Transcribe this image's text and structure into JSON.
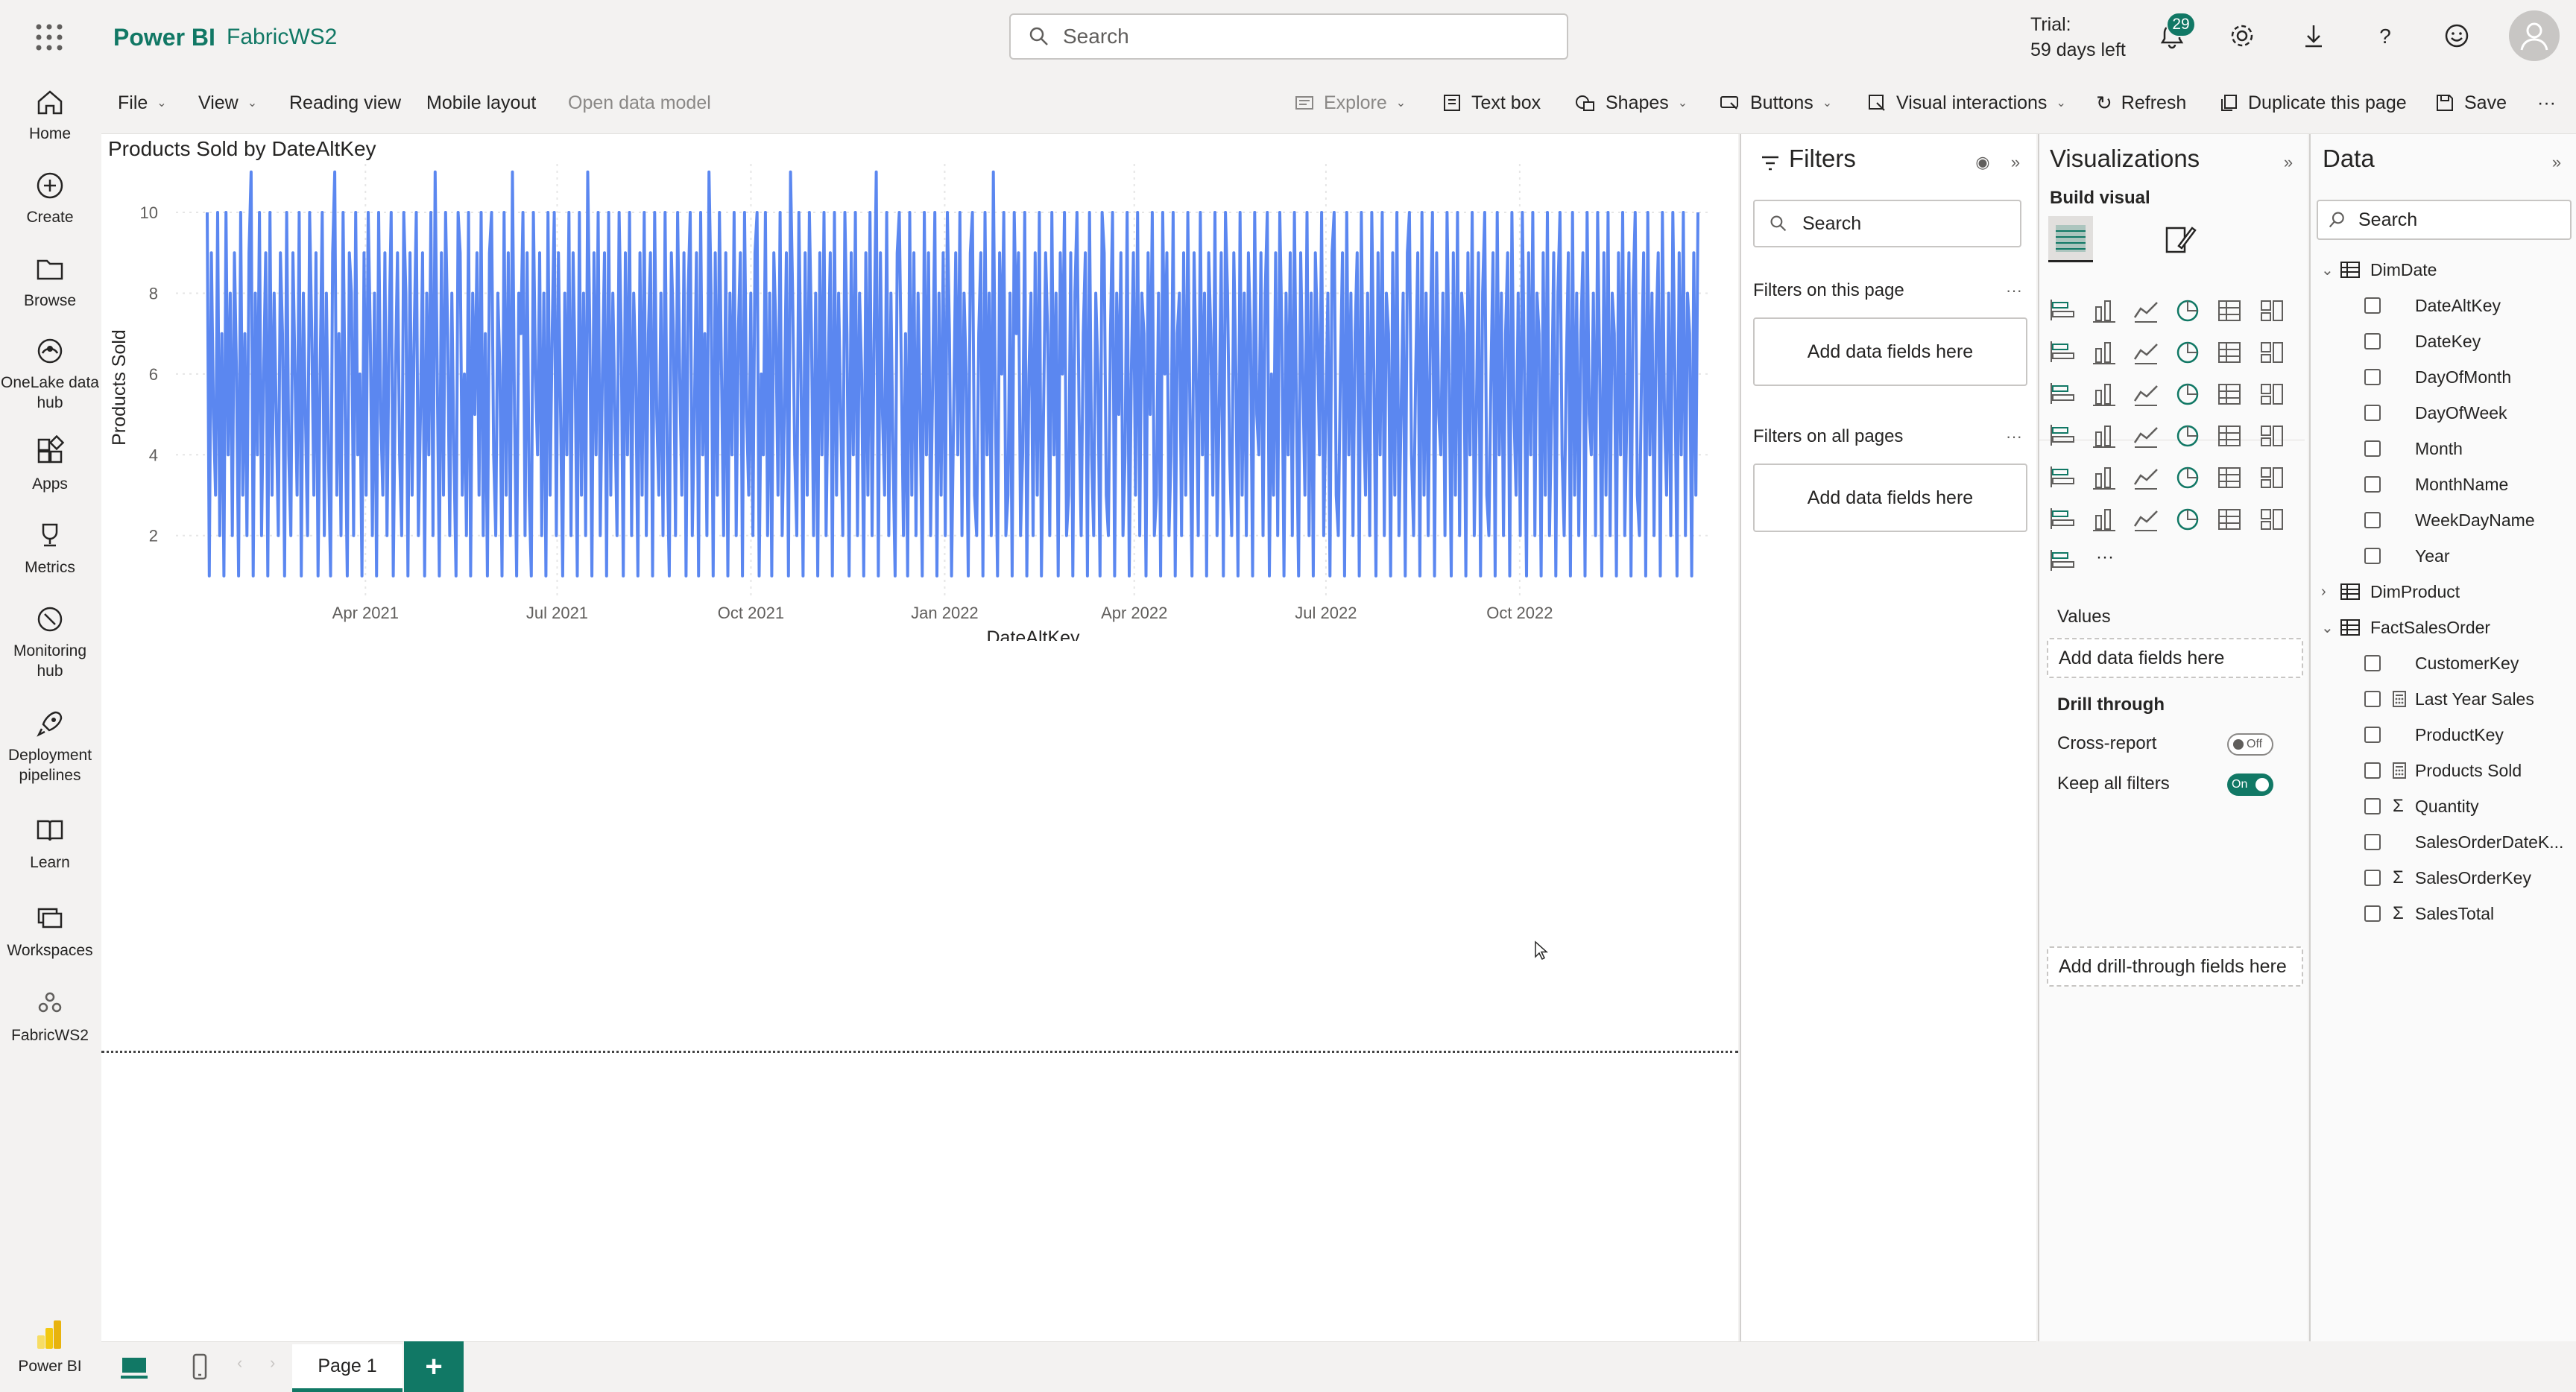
{
  "header": {
    "brand": "Power BI",
    "workspace": "FabricWS2",
    "search_placeholder": "Search",
    "trial_line1": "Trial:",
    "trial_line2": "59 days left",
    "notifications_count": "29",
    "accent": "#117865"
  },
  "leftnav": [
    {
      "label": "Home",
      "icon": "home-icon"
    },
    {
      "label": "Create",
      "icon": "plus-circle-icon"
    },
    {
      "label": "Browse",
      "icon": "folder-icon"
    },
    {
      "label": "OneLake data hub",
      "icon": "onelake-icon"
    },
    {
      "label": "Apps",
      "icon": "apps-icon"
    },
    {
      "label": "Metrics",
      "icon": "trophy-icon"
    },
    {
      "label": "Monitoring hub",
      "icon": "monitor-icon"
    },
    {
      "label": "Deployment pipelines",
      "icon": "rocket-icon"
    },
    {
      "label": "Learn",
      "icon": "book-icon"
    },
    {
      "label": "Workspaces",
      "icon": "workspaces-icon"
    },
    {
      "label": "FabricWS2",
      "icon": "workspace-icon"
    },
    {
      "label": "Power BI",
      "icon": "powerbi-logo-icon"
    }
  ],
  "cmdbar": {
    "file": "File",
    "view": "View",
    "reading_view": "Reading view",
    "mobile_layout": "Mobile layout",
    "open_data_model": "Open data model",
    "explore": "Explore",
    "text_box": "Text box",
    "shapes": "Shapes",
    "buttons": "Buttons",
    "visual_interactions": "Visual interactions",
    "refresh": "Refresh",
    "duplicate_page": "Duplicate this page",
    "save": "Save",
    "more": "···"
  },
  "chart": {
    "title": "Products Sold by DateAltKey",
    "xlabel": "DateAltKey",
    "ylabel": "Products Sold"
  },
  "chart_data": {
    "type": "line",
    "title": "Products Sold by DateAltKey",
    "xlabel": "DateAltKey",
    "ylabel": "Products Sold",
    "x_range": [
      "2021-01-01",
      "2022-12-31"
    ],
    "ylim": [
      0.5,
      11.2
    ],
    "y_ticks": [
      2,
      4,
      6,
      8,
      10
    ],
    "x_ticks": [
      "Apr 2021",
      "Jul 2021",
      "Oct 2021",
      "Jan 2022",
      "Apr 2022",
      "Jul 2022",
      "Oct 2022"
    ],
    "x_tick_dates": [
      "2021-04-01",
      "2021-07-01",
      "2021-10-01",
      "2022-01-01",
      "2022-04-01",
      "2022-07-01",
      "2022-10-01"
    ],
    "series_color": "#5b87f0",
    "grid": true,
    "series": [
      {
        "values": [
          10,
          1,
          9,
          5,
          3,
          10,
          2,
          7,
          1,
          10,
          4,
          8,
          2,
          9,
          6,
          1,
          10,
          3,
          7,
          2,
          9,
          11,
          1,
          8,
          4,
          10,
          2,
          6,
          9,
          1,
          10,
          3,
          8,
          5,
          2,
          9,
          7,
          1,
          10,
          4,
          2,
          9,
          6,
          3,
          10,
          1,
          8,
          5,
          2,
          10,
          7,
          3,
          9,
          1,
          6,
          10,
          2,
          8,
          4,
          1,
          9,
          11,
          3,
          7,
          2,
          10,
          5,
          1,
          9,
          8,
          2,
          10,
          4,
          6,
          1,
          9,
          3,
          10,
          7,
          2,
          8,
          1,
          10,
          5,
          3,
          9,
          2,
          7,
          10,
          1,
          6,
          9,
          4,
          2,
          10,
          8,
          1,
          9,
          3,
          7,
          10,
          2,
          5,
          9,
          1,
          8,
          4,
          10,
          2,
          11,
          6,
          1,
          9,
          3,
          10,
          7,
          2,
          8,
          4,
          1,
          10,
          9,
          3,
          6,
          2,
          10,
          1,
          8,
          5,
          9,
          3,
          10,
          2,
          7,
          1,
          9,
          10,
          4,
          2,
          8,
          6,
          1,
          10,
          3,
          9,
          2,
          11,
          5,
          1,
          8,
          7,
          10,
          2,
          9,
          3,
          1,
          10,
          6,
          4,
          9,
          2,
          8,
          1,
          10,
          3,
          7,
          10,
          2,
          9,
          5,
          1,
          8,
          4,
          10,
          2,
          9,
          6,
          1,
          10,
          3,
          8,
          2,
          11,
          7,
          1,
          9,
          4,
          10,
          2,
          6,
          9,
          1,
          10,
          3,
          8,
          5,
          2,
          10,
          7,
          1,
          9,
          4,
          10,
          2,
          8,
          6,
          1,
          9,
          3,
          10,
          2,
          7,
          9,
          1,
          10,
          5,
          3,
          8,
          2,
          10,
          4,
          1,
          9,
          7,
          2,
          10,
          6,
          3,
          9,
          1,
          8,
          10,
          2,
          5,
          9,
          1,
          10,
          4,
          7,
          2,
          11,
          8,
          1,
          9,
          3,
          10,
          6,
          2,
          9,
          1,
          8,
          4,
          10,
          2,
          7,
          9,
          1,
          10,
          5,
          3,
          8,
          2,
          9,
          10,
          1,
          6,
          4,
          10,
          2,
          8,
          1,
          9,
          7,
          3,
          10,
          2,
          5,
          9,
          1,
          11,
          8,
          4,
          2,
          10,
          6,
          1,
          9,
          3,
          10,
          7,
          2,
          8,
          1,
          9,
          4,
          10,
          2,
          6,
          9,
          1,
          10,
          3,
          8,
          5,
          2,
          10,
          7,
          1,
          9,
          4,
          10,
          2,
          8,
          6,
          1,
          9,
          3,
          10,
          2,
          7,
          11,
          1,
          9,
          5,
          3,
          10,
          2,
          8,
          4,
          1,
          9,
          10,
          6,
          2,
          7,
          1,
          10,
          3,
          9,
          2,
          8,
          5,
          1,
          10,
          4,
          9,
          2,
          6,
          10,
          1,
          8,
          3,
          9,
          2,
          10,
          7,
          1,
          5,
          9,
          4,
          10,
          2,
          8,
          6,
          1,
          9,
          10,
          3,
          2,
          7,
          9,
          1,
          10,
          4,
          8,
          2,
          11,
          5,
          1,
          9,
          6,
          10,
          2,
          3,
          8,
          1,
          10,
          7,
          9,
          2,
          4,
          10,
          1,
          6,
          8,
          2,
          9,
          3,
          10,
          1,
          5,
          9,
          7,
          2,
          10,
          4,
          8,
          1,
          9,
          6,
          10,
          2,
          3,
          9,
          1,
          8,
          10,
          5,
          2,
          7,
          9,
          1,
          10,
          4,
          2,
          8,
          6,
          1,
          10,
          9,
          3,
          2,
          7,
          10,
          1,
          8,
          5,
          9,
          2,
          4,
          10,
          1,
          6,
          9,
          3,
          10,
          2,
          8,
          7,
          1,
          9,
          5,
          10,
          2,
          3,
          8,
          1,
          10,
          6,
          9,
          2,
          4,
          10,
          1,
          7,
          8,
          2,
          9,
          3,
          10,
          5,
          1,
          9,
          6,
          2,
          10,
          4,
          8,
          1,
          9,
          7,
          3,
          10,
          2,
          5,
          9,
          1,
          10,
          8,
          4,
          2,
          9,
          6,
          1,
          10,
          3,
          8,
          2,
          9,
          7,
          1,
          10,
          5,
          4,
          9,
          2,
          8,
          10,
          1,
          6,
          3,
          9,
          2,
          10,
          7,
          1,
          8,
          4,
          9,
          2,
          10,
          5,
          1,
          9,
          6,
          3,
          10,
          2,
          8,
          1,
          9,
          7,
          4,
          10,
          2,
          5,
          8,
          1,
          9,
          10,
          3,
          2,
          6,
          9,
          1,
          10,
          4,
          8,
          2,
          7,
          9,
          1,
          10,
          5,
          3,
          8,
          2,
          10,
          6,
          1,
          9,
          4,
          10,
          2,
          8,
          7,
          1,
          9,
          3,
          10,
          2,
          5,
          8,
          1,
          9,
          10,
          4,
          2,
          6,
          9,
          1,
          10,
          3,
          8,
          2,
          7,
          10,
          1,
          9,
          5,
          4,
          8,
          2,
          10,
          6,
          1,
          9,
          3,
          10,
          2,
          8,
          7,
          1,
          9,
          4,
          10,
          2,
          5,
          9,
          1,
          8,
          10,
          3,
          2,
          6,
          9,
          1,
          10,
          4,
          8,
          2,
          7,
          9,
          1,
          10,
          5,
          3,
          8,
          2,
          10,
          6,
          1,
          9,
          4,
          10,
          2,
          8,
          7,
          1,
          9,
          3,
          10,
          2,
          5,
          9,
          1,
          8,
          10,
          4,
          2,
          6,
          9,
          1,
          10,
          3,
          8,
          2,
          7,
          9,
          1,
          10,
          5,
          4,
          8,
          2,
          10,
          6,
          1,
          9,
          3,
          10,
          2,
          8,
          7,
          1,
          9,
          4,
          10,
          2,
          5,
          9,
          1,
          8,
          10,
          3,
          2,
          6,
          9,
          1,
          10,
          4,
          8,
          2,
          7,
          9,
          1,
          10,
          5,
          3,
          8,
          2,
          10,
          6,
          1,
          9,
          4,
          10,
          2,
          8,
          7,
          1,
          9,
          3,
          10
        ]
      }
    ]
  },
  "filters": {
    "title": "Filters",
    "search_placeholder": "Search",
    "on_this_page": "Filters on this page",
    "on_all_pages": "Filters on all pages",
    "add_fields": "Add data fields here",
    "more": "···"
  },
  "visualizations": {
    "title": "Visualizations",
    "build_visual": "Build visual",
    "values_label": "Values",
    "values_well": "Add data fields here",
    "drill_through": "Drill through",
    "cross_report": "Cross-report",
    "cross_report_state": "Off",
    "keep_all_filters": "Keep all filters",
    "keep_all_filters_state": "On",
    "drill_well": "Add drill-through fields here",
    "more_visuals": "···"
  },
  "data": {
    "title": "Data",
    "search_placeholder": "Search",
    "tables": [
      {
        "name": "DimDate",
        "expanded": true,
        "fields": [
          {
            "name": "DateAltKey",
            "kind": "column"
          },
          {
            "name": "DateKey",
            "kind": "column"
          },
          {
            "name": "DayOfMonth",
            "kind": "column"
          },
          {
            "name": "DayOfWeek",
            "kind": "column"
          },
          {
            "name": "Month",
            "kind": "column"
          },
          {
            "name": "MonthName",
            "kind": "column"
          },
          {
            "name": "WeekDayName",
            "kind": "column"
          },
          {
            "name": "Year",
            "kind": "column"
          }
        ]
      },
      {
        "name": "DimProduct",
        "expanded": false,
        "fields": []
      },
      {
        "name": "FactSalesOrder",
        "expanded": true,
        "fields": [
          {
            "name": "CustomerKey",
            "kind": "column"
          },
          {
            "name": "Last Year Sales",
            "kind": "measure"
          },
          {
            "name": "ProductKey",
            "kind": "column"
          },
          {
            "name": "Products Sold",
            "kind": "measure"
          },
          {
            "name": "Quantity",
            "kind": "sum"
          },
          {
            "name": "SalesOrderDateK...",
            "kind": "column"
          },
          {
            "name": "SalesOrderKey",
            "kind": "sum"
          },
          {
            "name": "SalesTotal",
            "kind": "sum"
          }
        ]
      }
    ]
  },
  "footer": {
    "page_tab": "Page 1",
    "add_page": "+"
  }
}
